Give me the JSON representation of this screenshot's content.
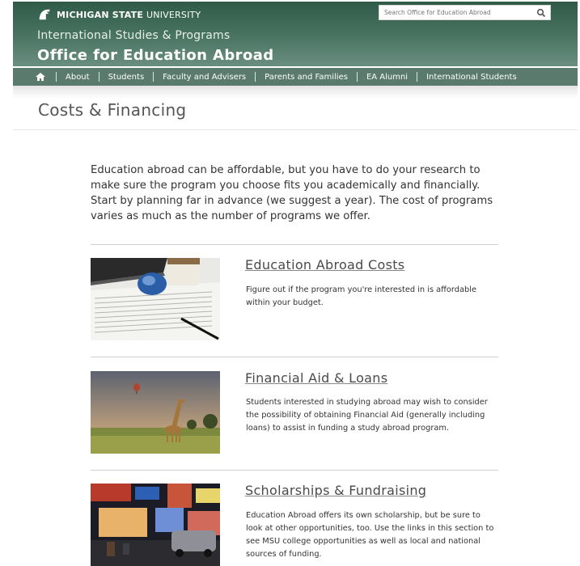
{
  "header": {
    "brand_bold": "MICHIGAN STATE",
    "brand_normal": "UNIVERSITY",
    "subtitle": "International Studies & Programs",
    "title": "Office for Education Abroad",
    "search_placeholder": "Search Office for Education Abroad",
    "colors": {
      "header_dark": "#2f5a48",
      "nav": "#597a6d"
    }
  },
  "nav": {
    "items": [
      "About",
      "Students",
      "Faculty and Advisers",
      "Parents and Families",
      "EA Alumni",
      "International Students"
    ]
  },
  "page": {
    "title": "Costs & Financing",
    "intro": "Education abroad can be affordable, but you have to do your research to make sure the program you choose fits you academically and financially. Start by planning far in advance (we suggest a year). The cost of programs varies as much as the number of programs we offer."
  },
  "sections": [
    {
      "title": "Education Abroad Costs",
      "desc": "Figure out if the program you're interested in is affordable within your budget."
    },
    {
      "title": "Financial Aid & Loans",
      "desc": "Students interested in studying abroad may wish to consider the possibility of obtaining Financial Aid (generally including loans) to assist in funding a study abroad program."
    },
    {
      "title": "Scholarships & Fundraising",
      "desc": "Education Abroad offers its own scholarship, but be sure to look at other opportunities, too. Use the links in this section to see MSU college opportunities as well as local and national sources of funding."
    }
  ]
}
